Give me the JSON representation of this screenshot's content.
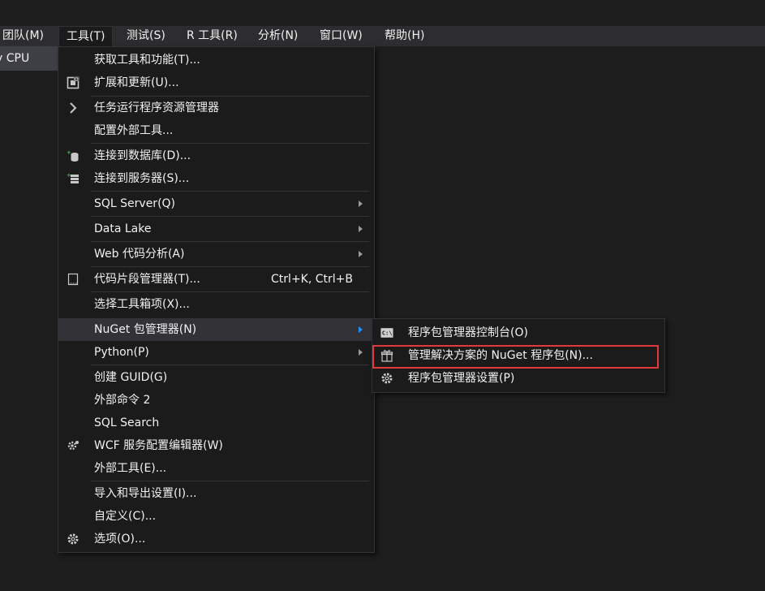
{
  "menubar": {
    "items": [
      {
        "label": "团队(M)"
      },
      {
        "label": "工具(T)"
      },
      {
        "label": "测试(S)"
      },
      {
        "label": "R 工具(R)"
      },
      {
        "label": "分析(N)"
      },
      {
        "label": "窗口(W)"
      },
      {
        "label": "帮助(H)"
      }
    ]
  },
  "toolbar": {
    "platform": "y CPU"
  },
  "tools_menu": {
    "items": [
      {
        "label": "获取工具和功能(T)...",
        "icon": "none"
      },
      {
        "label": "扩展和更新(U)...",
        "icon": "extensions-icon"
      },
      {
        "label": "任务运行程序资源管理器",
        "icon": "chevron-right-icon"
      },
      {
        "label": "配置外部工具...",
        "icon": "none"
      },
      {
        "label": "连接到数据库(D)...",
        "icon": "database-connect-icon"
      },
      {
        "label": "连接到服务器(S)...",
        "icon": "server-connect-icon"
      },
      {
        "label": "SQL Server(Q)",
        "icon": "none"
      },
      {
        "label": "Data Lake",
        "icon": "none"
      },
      {
        "label": "Web 代码分析(A)",
        "icon": "none"
      },
      {
        "label": "代码片段管理器(T)...",
        "shortcut": "Ctrl+K, Ctrl+B",
        "icon": "snippet-icon"
      },
      {
        "label": "选择工具箱项(X)...",
        "icon": "none"
      },
      {
        "label": "NuGet 包管理器(N)",
        "icon": "none"
      },
      {
        "label": "Python(P)",
        "icon": "none"
      },
      {
        "label": "创建 GUID(G)",
        "icon": "none"
      },
      {
        "label": "外部命令 2",
        "icon": "none"
      },
      {
        "label": "SQL Search",
        "icon": "none"
      },
      {
        "label": "WCF 服务配置编辑器(W)",
        "icon": "wcf-gear-icon"
      },
      {
        "label": "外部工具(E)...",
        "icon": "none"
      },
      {
        "label": "导入和导出设置(I)...",
        "icon": "none"
      },
      {
        "label": "自定义(C)...",
        "icon": "none"
      },
      {
        "label": "选项(O)...",
        "icon": "gear-icon"
      }
    ]
  },
  "nuget_submenu": {
    "items": [
      {
        "label": "程序包管理器控制台(O)",
        "icon": "console-icon"
      },
      {
        "label": "管理解决方案的 NuGet 程序包(N)...",
        "icon": "package-icon"
      },
      {
        "label": "程序包管理器设置(P)",
        "icon": "gear-icon"
      }
    ]
  },
  "colors": {
    "background": "#1e1e1e",
    "menu_background": "#1b1b1c",
    "highlight": "#333337",
    "submenu_arrow_active": "#1e90ff",
    "annotation_box": "#e03a3a"
  }
}
